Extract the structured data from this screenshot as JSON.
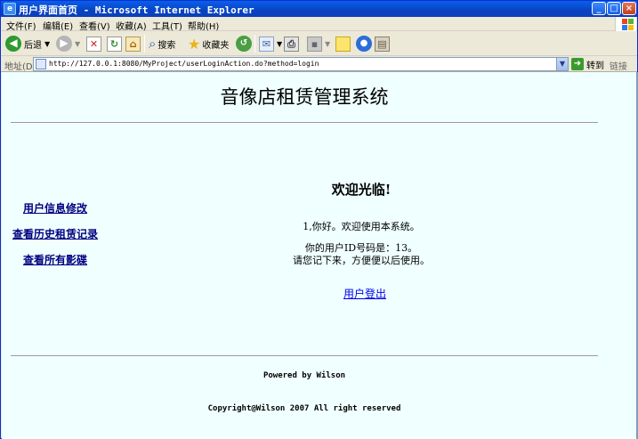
{
  "window": {
    "title": "用户界面首页 - Microsoft Internet Explorer",
    "min_glyph": "_",
    "max_glyph": "□",
    "close_glyph": "×"
  },
  "menu": {
    "items": [
      "文件(F)",
      "编辑(E)",
      "查看(V)",
      "收藏(A)",
      "工具(T)",
      "帮助(H)"
    ]
  },
  "toolbar": {
    "back_label": "后退",
    "search_label": "搜索",
    "favorites_label": "收藏夹"
  },
  "address": {
    "label": "地址(D)",
    "url": "http://127.0.0.1:8080/MyProject/userLoginAction.do?method=login",
    "go_label": "转到",
    "links_label": "链接"
  },
  "page": {
    "title": "音像店租赁管理系统",
    "nav": [
      "用户信息修改",
      "查看历史租赁记录",
      "查看所有影碟"
    ],
    "welcome": "欢迎光临!",
    "greeting": "1,你好。欢迎使用本系统。",
    "id_line": "你的用户ID号码是：13。",
    "remember_line": "请您记下来，方便便以后使用。",
    "logout": "用户登出",
    "powered_by": "Powered by Wilson",
    "copyright": "Copyright@Wilson 2007 All right reserved"
  },
  "colors": {
    "titlebar": "#0A4FD6",
    "content_bg": "#F0FFFF",
    "nav_link": "#000080",
    "logout_link": "#0000EE"
  }
}
